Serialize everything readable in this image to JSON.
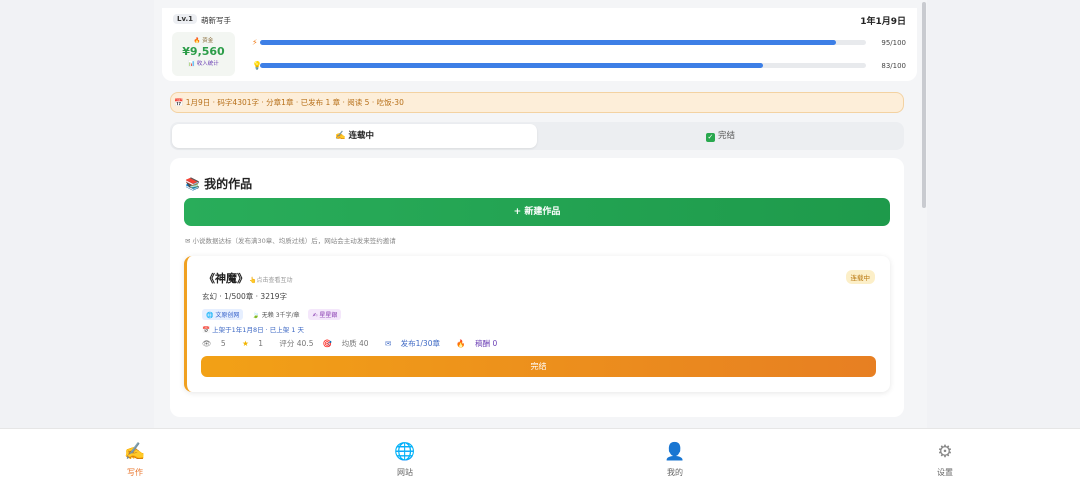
{
  "header": {
    "level": "Lv.1",
    "title": "萌新写手",
    "date": "1年1月9日",
    "money_label": "资金",
    "money_value": "¥9,560",
    "income_link": "收入统计",
    "energy": {
      "icon": "lightning-icon",
      "value": 95,
      "max": 100,
      "text": "95/100"
    },
    "inspiration": {
      "icon": "bulb-icon",
      "value": 83,
      "max": 100,
      "text": "83/100"
    },
    "colors": {
      "bar": "#3d7fe6",
      "money": "#2c9d49"
    }
  },
  "log": "1月9日 · 码字4301字 · 分章1章 · 已发布 1 章 · 阅读 5 · 吃饭-30",
  "tabs": [
    {
      "label": "连载中",
      "icon": "writing-hand-icon",
      "active": true
    },
    {
      "label": "完结",
      "icon": "check-icon",
      "active": false
    }
  ],
  "works": {
    "title": "我的作品",
    "new_button": "+ 新建作品",
    "hint": "小说数据达标（发布满30章、均质过线）后，网站会主动发来签约邀请",
    "items": [
      {
        "title": "《神魔》",
        "tip": "点击查看互动",
        "status": "连载中",
        "meta": "玄幻 · 1/500章 · 3219字",
        "tags": {
          "site": "文原创网",
          "plain": "无赖",
          "words": "3千字/章",
          "fans": "星星銀"
        },
        "shelf": "上架于1年1月8日 · 已上架 1 天",
        "stats": {
          "views": "5",
          "stars": "1",
          "score": "评分 40.5",
          "quality": "均质 40",
          "published": "发布1/30章",
          "pay": "稿酬 0"
        },
        "finish_button": "完结"
      }
    ]
  },
  "bottom_nav": [
    {
      "label": "写作",
      "icon": "writing-hand-icon",
      "active": true
    },
    {
      "label": "网站",
      "icon": "globe-icon",
      "active": false
    },
    {
      "label": "我的",
      "icon": "user-icon",
      "active": false
    },
    {
      "label": "设置",
      "icon": "gear-icon",
      "active": false
    }
  ]
}
